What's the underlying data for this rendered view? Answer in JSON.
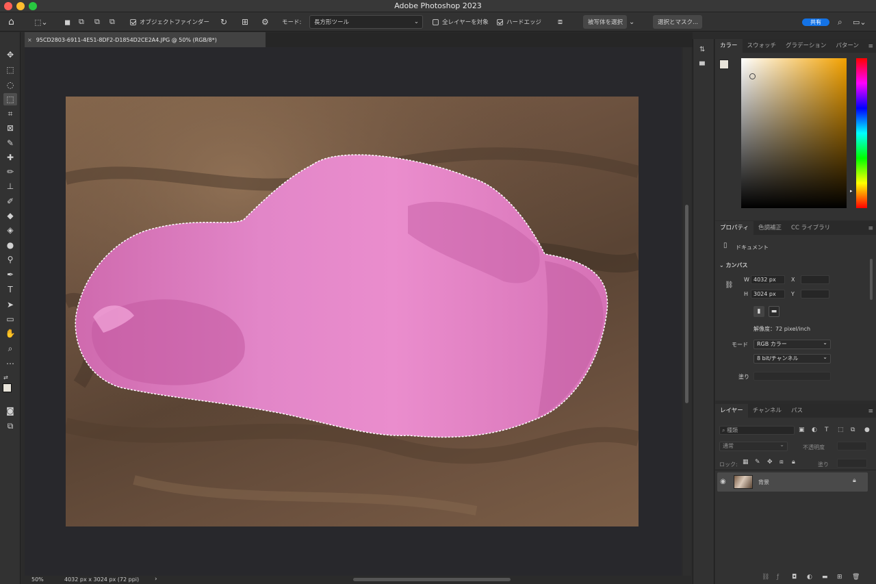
{
  "app": {
    "title": "Adobe Photoshop 2023"
  },
  "options_bar": {
    "object_finder_label": "オブジェクトファインダー",
    "mode_label": "モード:",
    "mode_value": "長方形ツール",
    "sample_all_layers_label": "全レイヤーを対象",
    "hard_edge_label": "ハードエッジ",
    "select_subject_label": "被写体を選択",
    "select_and_mask_label": "選択とマスク...",
    "share_label": "共有"
  },
  "document": {
    "tab_title": "95CD2803-6911-4E51-8DF2-D1854D2CE2A4.JPG @ 50% (RGB/8*)",
    "zoom": "50%",
    "info": "4032 px x 3024 px (72 ppi)"
  },
  "color_panel": {
    "tabs": [
      "カラー",
      "スウォッチ",
      "グラデーション",
      "パターン"
    ],
    "active_tab": 0
  },
  "properties_panel": {
    "tabs": [
      "プロパティ",
      "色調補正",
      "CC ライブラリ"
    ],
    "doc_label": "ドキュメント",
    "canvas_section": "カンバス",
    "w_label": "W",
    "w_value": "4032 px",
    "h_label": "H",
    "h_value": "3024 px",
    "x_label": "X",
    "y_label": "Y",
    "resolution": "解像度：72 pixel/inch",
    "mode_label": "モード",
    "mode_value": "RGB カラー",
    "depth_value": "8 bit/チャンネル",
    "fill_label": "塗り"
  },
  "layers_panel": {
    "tabs": [
      "レイヤー",
      "チャンネル",
      "パス"
    ],
    "search_placeholder": "種類",
    "blend_mode": "通常",
    "opacity_label": "不透明度",
    "lock_label": "ロック:",
    "fill_label": "塗り",
    "layer_name": "背景"
  },
  "colors": {
    "accent": "#1473e6",
    "selection_overlay": "#e882c8"
  }
}
